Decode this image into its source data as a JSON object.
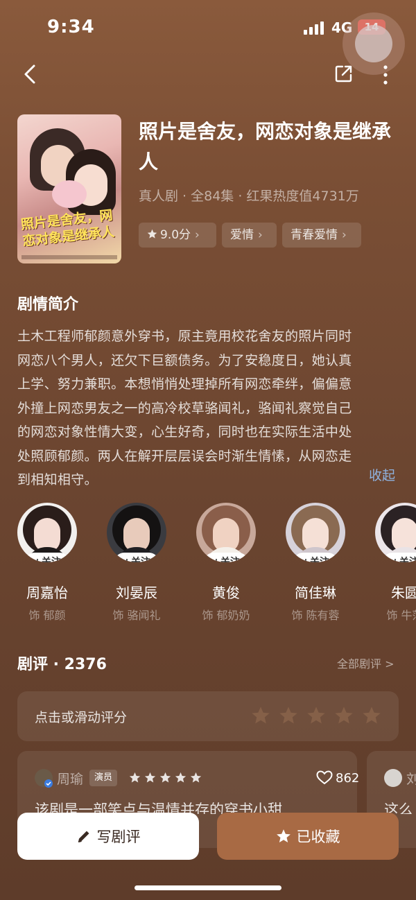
{
  "status_bar": {
    "time": "9:34",
    "network": "4G",
    "battery": "14"
  },
  "drama": {
    "title": "照片是舍友，网恋对象是继承人",
    "meta": "真人剧 · 全84集 · 红果热度值4731万",
    "poster_text": "照片是舍友，网恋对象是继承人",
    "tags": [
      {
        "label": "9.0分",
        "icon": "star-icon"
      },
      {
        "label": "爱情"
      },
      {
        "label": "青春爱情"
      }
    ]
  },
  "synopsis": {
    "heading": "剧情简介",
    "lines": [
      "土木工程师郁颜意外穿书，原主竟用校花舍友的照片同时",
      "网恋八个男人，还欠下巨额债务。为了安稳度日，她认真",
      "上学、努力兼职。本想悄悄处理掉所有网恋牵绊，偏偏意",
      "外撞上网恋男友之一的高冷校草骆闻礼，骆闻礼察觉自己",
      "的网恋对象性情大变，心生好奇，同时也在实际生活中处",
      "处照顾郁颜。两人在解开层层误会时渐生情愫，从网恋走",
      "到相知相守。"
    ],
    "collapse_label": "收起"
  },
  "cast": {
    "follow_label": "+关注",
    "members": [
      {
        "name": "周嘉怡",
        "role": "饰 郁颜"
      },
      {
        "name": "刘晏辰",
        "role": "饰 骆闻礼"
      },
      {
        "name": "黄俊",
        "role": "饰 郁奶奶"
      },
      {
        "name": "简佳琳",
        "role": "饰 陈有蓉"
      },
      {
        "name": "朱圆",
        "role": "饰 牛萍"
      }
    ]
  },
  "reviews": {
    "heading": "剧评 · 2376",
    "all_label": "全部剧评 >",
    "rate_prompt": "点击或滑动评分",
    "rating_stars": 5,
    "cards": [
      {
        "author": "周瑜",
        "badge": "演员",
        "stars": 5,
        "likes": "862",
        "text": "该剧是一部笑点与温情并存的穿书小甜"
      },
      {
        "author": "刘",
        "text": "这么"
      }
    ]
  },
  "actions": {
    "write_label": "写剧评",
    "fav_label": "已收藏"
  },
  "colors": {
    "accent": "#a86a44",
    "link": "#8fb3e0",
    "background": "#6b4530"
  }
}
